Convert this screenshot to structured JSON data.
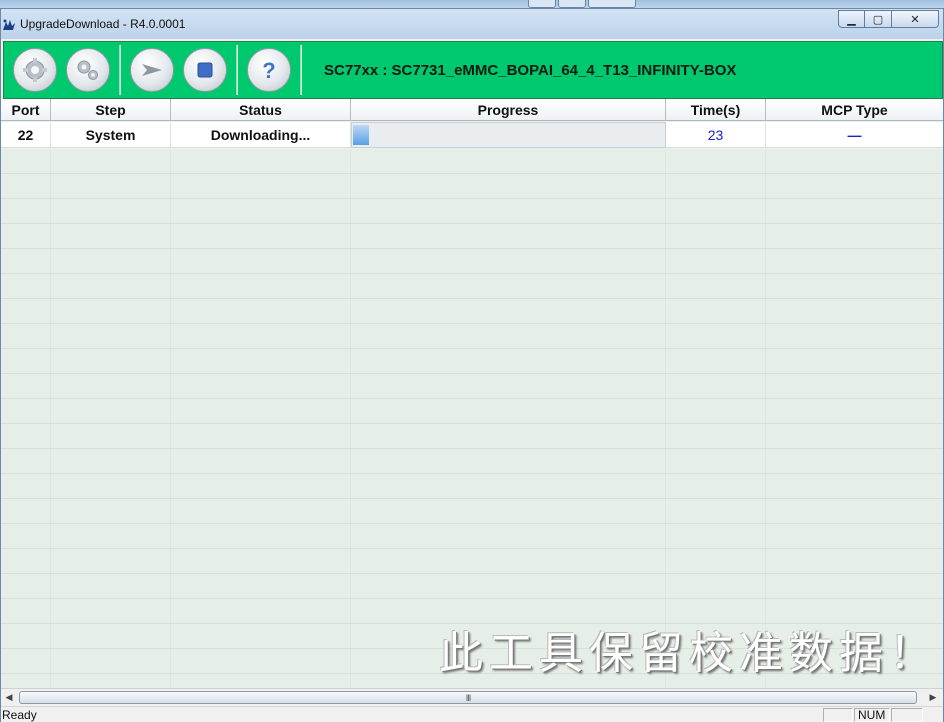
{
  "window": {
    "title": "UpgradeDownload - R4.0.0001",
    "minimize_glyph": "▁",
    "maximize_glyph": "▢",
    "close_glyph": "✕"
  },
  "toolbar": {
    "model": "SC77xx : SC7731_eMMC_BOPAI_64_4_T13_INFINITY-BOX",
    "buttons": [
      {
        "icon": "gear-icon"
      },
      {
        "icon": "settings-gears-icon"
      },
      {
        "icon": "start-arrow-icon"
      },
      {
        "icon": "stop-icon"
      },
      {
        "icon": "help-icon"
      }
    ]
  },
  "table": {
    "columns": [
      "Port",
      "Step",
      "Status",
      "Progress",
      "Time(s)",
      "MCP Type"
    ],
    "rows": [
      {
        "port": "22",
        "step": "System",
        "status": "Downloading...",
        "progress_percent": 5,
        "time": "23",
        "mcp": "—"
      }
    ]
  },
  "watermark": "此工具保留校准数据！",
  "scrollbar": {
    "left_arrow": "◀",
    "right_arrow": "▶",
    "grip": "III"
  },
  "statusbar": {
    "text": "Ready",
    "num": "NUM"
  },
  "colors": {
    "toolbar_bg": "#00c86f",
    "progress_fill": "#5aa0e6",
    "time_text": "#1a24c6"
  }
}
